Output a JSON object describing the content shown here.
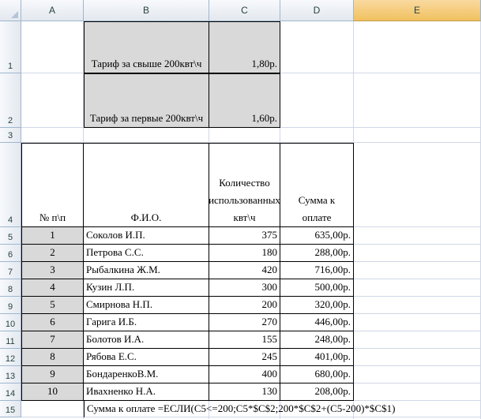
{
  "columns": [
    "A",
    "B",
    "C",
    "D",
    "E"
  ],
  "rows": [
    "1",
    "2",
    "3",
    "4",
    "5",
    "6",
    "7",
    "8",
    "9",
    "10",
    "11",
    "12",
    "13",
    "14",
    "15"
  ],
  "tariffs": [
    {
      "label": "Тариф за свыше 200квт\\ч",
      "value": "1,80р."
    },
    {
      "label": "Тариф за первые 200квт\\ч",
      "value": "1,60р."
    }
  ],
  "table": {
    "headers": {
      "num": "№ п\\п",
      "name": "Ф.И.О.",
      "kwh": "Количество использованных квт\\ч",
      "sum": "Сумма к оплате"
    },
    "rows": [
      {
        "num": "1",
        "name": "Соколов И.П.",
        "kwh": "375",
        "sum": "635,00р."
      },
      {
        "num": "2",
        "name": "Петрова С.С.",
        "kwh": "180",
        "sum": "288,00р."
      },
      {
        "num": "3",
        "name": "Рыбалкина Ж.М.",
        "kwh": "420",
        "sum": "716,00р."
      },
      {
        "num": "4",
        "name": "Кузин Л.П.",
        "kwh": "300",
        "sum": "500,00р."
      },
      {
        "num": "5",
        "name": "Смирнова Н.П.",
        "kwh": "200",
        "sum": "320,00р."
      },
      {
        "num": "6",
        "name": "Гарига И.Б.",
        "kwh": "270",
        "sum": "446,00р."
      },
      {
        "num": "7",
        "name": "Болотов И.А.",
        "kwh": "155",
        "sum": "248,00р."
      },
      {
        "num": "8",
        "name": "Рябова Е.С.",
        "kwh": "245",
        "sum": "401,00р."
      },
      {
        "num": "9",
        "name": "БондаренкоВ.М.",
        "kwh": "400",
        "sum": "680,00р."
      },
      {
        "num": "10",
        "name": "Ивахненко Н.А.",
        "kwh": "130",
        "sum": "208,00р."
      }
    ]
  },
  "formula_note": "Сумма к оплате =ЕСЛИ(C5<=200;C5*$C$2;200*$C$2+(C5-200)*$C$1)"
}
